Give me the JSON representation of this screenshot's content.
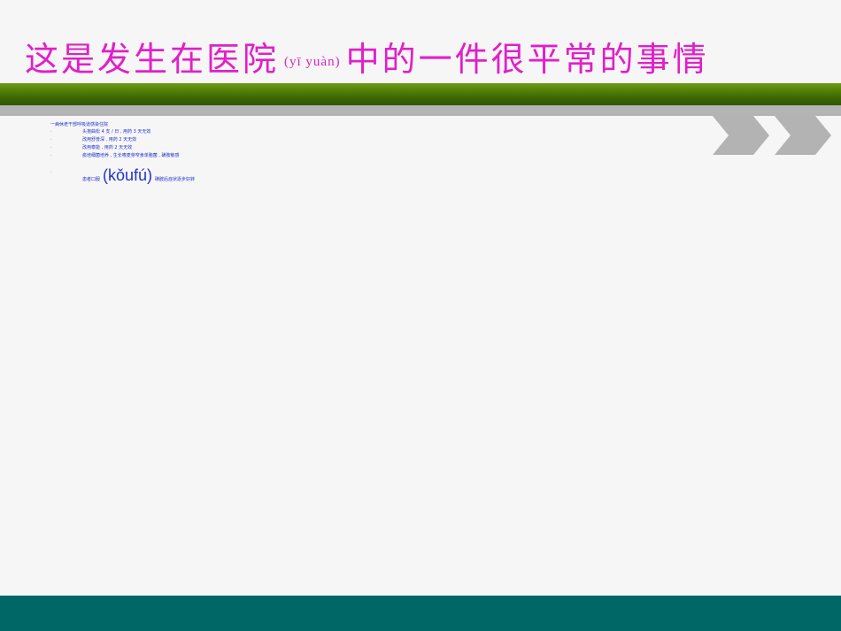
{
  "title": {
    "before": "这是发生在医院",
    "pinyin": "(yī yuàn)",
    "after": "中的一件很平常的事情"
  },
  "case": {
    "heading": "一病休老干部呼吸道感染住院",
    "items": [
      {
        "bullet": "·",
        "text": "头孢曲松 4 支 / 日 , 用药 3 天无效"
      },
      {
        "bullet": "·",
        "text": "改用舒普深 , 用药 2 天无效"
      },
      {
        "bullet": "·",
        "text": "改用泰能 , 用药 2 天无效"
      },
      {
        "bullet": "·",
        "text": "痰培细菌培养 , 生长嗜麦芽窄食单胞菌 , 磺胺敏感"
      }
    ],
    "last": {
      "bullet": "·",
      "pre": "患者口服",
      "pinyin": "(kǒufú)",
      "post": "磺胺后症状逐步好转"
    }
  },
  "colors": {
    "title": "#e020c8",
    "text": "#2233cc",
    "green_band": "#3f6b05",
    "gray_band": "#b4b4b4",
    "chevrons": "#b3b3b3",
    "footer": "#006666"
  },
  "icons": [
    "chevron-right-icon",
    "chevron-right-icon"
  ]
}
